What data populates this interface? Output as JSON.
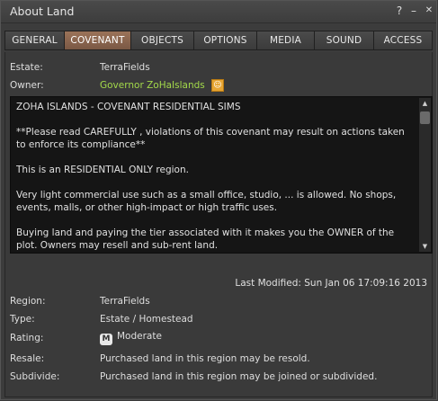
{
  "window": {
    "title": "About Land",
    "help_label": "?",
    "minimize_label": "–",
    "close_label": "✕"
  },
  "tabs": [
    {
      "label": "GENERAL"
    },
    {
      "label": "COVENANT"
    },
    {
      "label": "OBJECTS"
    },
    {
      "label": "OPTIONS"
    },
    {
      "label": "MEDIA"
    },
    {
      "label": "SOUND"
    },
    {
      "label": "ACCESS"
    }
  ],
  "active_tab": "COVENANT",
  "accent_color": "#8a6650",
  "estate": {
    "label": "Estate:",
    "value": "TerraFields"
  },
  "owner": {
    "label": "Owner:",
    "value": "Governor ZoHaIslands",
    "icon": "profile-icon"
  },
  "covenant": {
    "paragraphs": [
      "ZOHA ISLANDS - COVENANT RESIDENTIAL SIMS",
      "**Please read CAREFULLY , violations of this covenant may result on actions taken to enforce its compliance**",
      "This is an RESIDENTIAL ONLY region.",
      "Very light commercial use such as a small office, studio, ... is allowed. No shops, events, malls, or other high-impact or high traffic uses.",
      "Buying land and paying the tier associated with it makes you the OWNER of the plot. Owners may resell and sub-rent land."
    ]
  },
  "last_modified": "Last Modified: Sun Jan 06 17:09:16 2013",
  "details": {
    "region": {
      "label": "Region:",
      "value": "TerraFields"
    },
    "type": {
      "label": "Type:",
      "value": "Estate / Homestead"
    },
    "rating": {
      "label": "Rating:",
      "badge": "M",
      "value": "Moderate"
    },
    "resale": {
      "label": "Resale:",
      "value": "Purchased land in this region may be resold."
    },
    "subdivide": {
      "label": "Subdivide:",
      "value": "Purchased land in this region may be joined or subdivided."
    }
  }
}
